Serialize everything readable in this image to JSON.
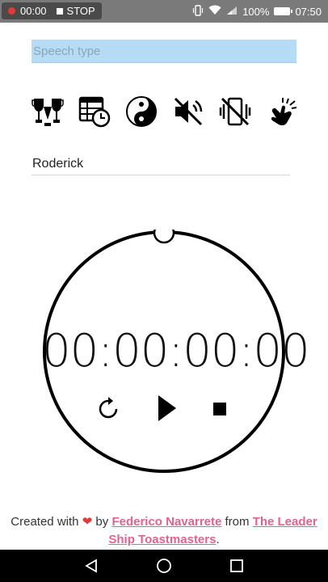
{
  "status_bar": {
    "recording_time": "00:00",
    "stop_label": "STOP",
    "battery": "100%",
    "clock": "07:50"
  },
  "speech_type": {
    "placeholder": "Speech type",
    "value": ""
  },
  "toolbar": {
    "icons": [
      "trophy-cups-icon",
      "schedule-calendar-clock-icon",
      "yin-yang-icon",
      "volume-off-icon",
      "vibrate-off-icon",
      "touch-flash-icon"
    ]
  },
  "name_field": {
    "value": "Roderick"
  },
  "timer": {
    "display": "00:00:00:00"
  },
  "footer": {
    "created_with": "Created with",
    "by": "by",
    "author": "Federico Navarrete",
    "from": "from",
    "club": "The Leader Ship Toastmasters",
    "period": "."
  }
}
